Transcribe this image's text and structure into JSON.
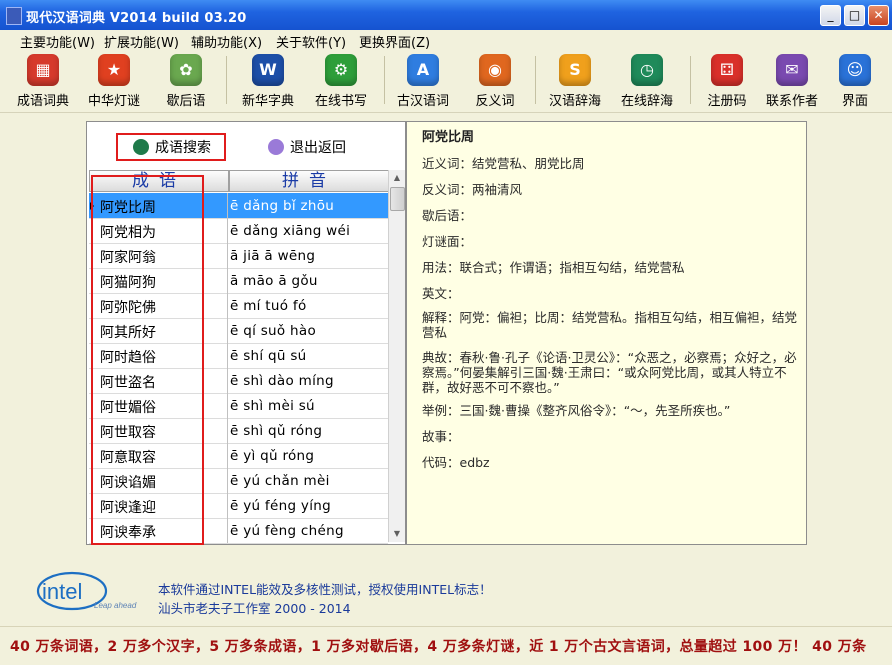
{
  "window": {
    "title": "现代汉语词典 V2014 build 03.20"
  },
  "window_controls": {
    "minimize": "_",
    "maximize": "□",
    "close": "✕"
  },
  "menu": [
    "主要功能(W)",
    "扩展功能(W)",
    "辅助功能(X)",
    "关于软件(Y)",
    "更换界面(Z)"
  ],
  "toolbar": [
    {
      "label": "成语词典",
      "icon": "grid-book-icon",
      "color": "#d63a2c",
      "glyph": "▦"
    },
    {
      "label": "中华灯谜",
      "icon": "star-icon",
      "color": "#e04020",
      "glyph": "★"
    },
    {
      "label": "歇后语",
      "icon": "leaf-icon",
      "color": "#6aa84f",
      "glyph": "✿"
    },
    {
      "label": "新华字典",
      "icon": "w-dictionary-icon",
      "color": "#1d4fa8",
      "glyph": "W"
    },
    {
      "label": "在线书写",
      "icon": "gear-write-icon",
      "color": "#2e9e3a",
      "glyph": "⚙"
    },
    {
      "label": "古汉语词",
      "icon": "app-store-icon",
      "color": "#2f7de0",
      "glyph": "A"
    },
    {
      "label": "反义词",
      "icon": "rss-icon",
      "color": "#e0671f",
      "glyph": "◉"
    },
    {
      "label": "汉语辞海",
      "icon": "s-icon",
      "color": "#f0a01c",
      "glyph": "S"
    },
    {
      "label": "在线辞海",
      "icon": "clock-icon",
      "color": "#1f8a5a",
      "glyph": "◷"
    },
    {
      "label": "注册码",
      "icon": "dice-icon",
      "color": "#d9302a",
      "glyph": "⚃"
    },
    {
      "label": "联系作者",
      "icon": "mail-icon",
      "color": "#7a4ab0",
      "glyph": "✉"
    },
    {
      "label": "界面",
      "icon": "finder-face-icon",
      "color": "#2a72d8",
      "glyph": "☺"
    }
  ],
  "actions": {
    "search": "成语搜索",
    "back": "退出返回"
  },
  "list": {
    "headers": [
      "成语",
      "拼音"
    ],
    "rows": [
      {
        "idiom": "阿党比周",
        "pinyin": "ē dǎng bǐ zhōu"
      },
      {
        "idiom": "阿党相为",
        "pinyin": "ē dǎng xiāng wéi"
      },
      {
        "idiom": "阿家阿翁",
        "pinyin": "ā jiā ā wēng"
      },
      {
        "idiom": "阿猫阿狗",
        "pinyin": "ā māo ā gǒu"
      },
      {
        "idiom": "阿弥陀佛",
        "pinyin": "ē mí tuó fó"
      },
      {
        "idiom": "阿其所好",
        "pinyin": "ē qí suǒ hào"
      },
      {
        "idiom": "阿时趋俗",
        "pinyin": "ē shí qū sú"
      },
      {
        "idiom": "阿世盗名",
        "pinyin": "ē shì dào míng"
      },
      {
        "idiom": "阿世媚俗",
        "pinyin": "ē shì mèi sú"
      },
      {
        "idiom": "阿世取容",
        "pinyin": "ē shì qǔ róng"
      },
      {
        "idiom": "阿意取容",
        "pinyin": "ē yì qǔ róng"
      },
      {
        "idiom": "阿谀谄媚",
        "pinyin": "ē yú chǎn mèi"
      },
      {
        "idiom": "阿谀逢迎",
        "pinyin": "ē yú féng yíng"
      },
      {
        "idiom": "阿谀奉承",
        "pinyin": "ē yú fèng chéng"
      }
    ],
    "selected_index": 0
  },
  "detail": {
    "title": "阿党比周",
    "lines": [
      "近义词：结党营私、朋党比周",
      "反义词：两袖清风",
      "歇后语：",
      "灯谜面：",
      "用法：联合式；作谓语；指相互勾结，结党营私",
      "英文：",
      "解释：阿党：偏袒；比周：结党营私。指相互勾结，相互偏袒，结党营私",
      "典故：春秋·鲁·孔子《论语·卫灵公》：“众恶之，必察焉；众好之，必察焉。”何晏集解引三国·魏·王肃曰：“或众阿党比周，或其人特立不群，故好恶不可不察也。”",
      "举例：三国·魏·曹操《整齐风俗令》：“～，先圣所疾也。”",
      "故事：",
      "代码：edbz"
    ]
  },
  "footer": {
    "logo_text": "intel",
    "logo_tagline": "Leap ahead",
    "line1": "本软件通过INTEL能效及多核性测试，授权使用INTEL标志！",
    "line2": "汕头市老夫子工作室 2000 - 2014",
    "ticker": "40 万条词语，2 万多个汉字，5 万多条成语，1 万多对歇后语，4 万多条灯谜，近 1 万个古文言语词，总量超过 100 万！ 40 万条"
  },
  "colors": {
    "title_bar": "#1f63e0",
    "selection": "#3399ff",
    "highlight_frame": "#e01c1c",
    "detail_bg": "#ffffe4",
    "ticker_text": "#a01010"
  }
}
